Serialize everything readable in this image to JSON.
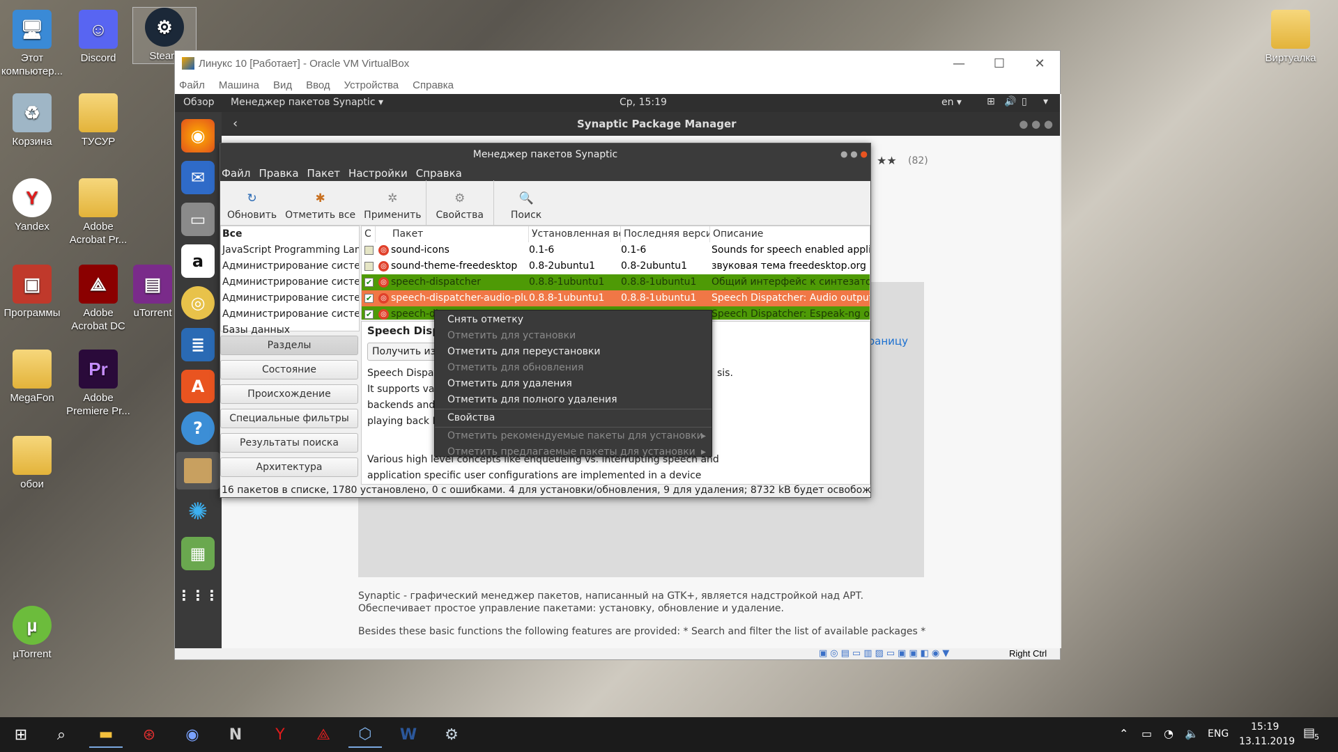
{
  "desktop": {
    "icons": [
      "Этот компьютер...",
      "Discord",
      "Steam",
      "Корзина",
      "ТУСУР",
      "Yandex",
      "Adobe Acrobat Pr...",
      "Программы",
      "Adobe Acrobat DC",
      "uTorrent",
      "MegaFon",
      "Adobe Premiere Pr...",
      "обои",
      "µTorrent",
      "Виртуалка"
    ]
  },
  "vbox": {
    "title": "Линукс 10 [Работает] - Oracle VM VirtualBox",
    "menu": [
      "Файл",
      "Машина",
      "Вид",
      "Ввод",
      "Устройства",
      "Справка"
    ],
    "host_key": "Right Ctrl"
  },
  "gnome": {
    "overview": "Обзор",
    "app_menu": "Менеджер пакетов Synaptic ▾",
    "clock": "Ср, 15:19",
    "lang": "en ▾"
  },
  "software_center": {
    "title": "Synaptic Package Manager",
    "rating_count": "(82)",
    "website_link": "етить домашнюю страницу",
    "desc1": "Synaptic - графический менеджер пакетов, написанный на GTK+, является надстройкой над APT. Обеспечивает простое управление пакетами: установку, обновление и удаление.",
    "desc2": "Besides these basic functions the following features are provided:  * Search and filter the list of available packages  *"
  },
  "synaptic": {
    "title": "Менеджер пакетов Synaptic",
    "menu": [
      "Файл",
      "Правка",
      "Пакет",
      "Настройки",
      "Справка"
    ],
    "toolbar": [
      "Обновить",
      "Отметить все",
      "Применить",
      "Свойства",
      "Поиск"
    ],
    "sections": [
      "Все",
      "JavaScript Programming Lang",
      "Администрирование систем",
      "Администрирование систем",
      "Администрирование систем",
      "Администрирование систем",
      "Базы данных"
    ],
    "filter_buttons": [
      "Разделы",
      "Состояние",
      "Происхождение",
      "Специальные фильтры",
      "Результаты поиска",
      "Архитектура"
    ],
    "columns": [
      "С",
      "Пакет",
      "Установленная ве",
      "Последняя версия",
      "Описание"
    ],
    "rows": [
      {
        "name": "sound-icons",
        "installed": "0.1-6",
        "latest": "0.1-6",
        "desc": "Sounds for speech enabled applic",
        "state": "normal"
      },
      {
        "name": "sound-theme-freedesktop",
        "installed": "0.8-2ubuntu1",
        "latest": "0.8-2ubuntu1",
        "desc": "звуковая тема freedesktop.org",
        "state": "normal"
      },
      {
        "name": "speech-dispatcher",
        "installed": "0.8.8-1ubuntu1",
        "latest": "0.8.8-1ubuntu1",
        "desc": "Общий интерфейс к синтезатор",
        "state": "green"
      },
      {
        "name": "speech-dispatcher-audio-plug",
        "installed": "0.8.8-1ubuntu1",
        "latest": "0.8.8-1ubuntu1",
        "desc": "Speech Dispatcher: Audio output",
        "state": "selected"
      },
      {
        "name": "speech-di",
        "installed": "",
        "latest": "",
        "desc": "Speech Dispatcher: Espeak-ng ou",
        "state": "green"
      }
    ],
    "detail_title": "Speech Disp",
    "get_button": "Получить из",
    "detail_lines": [
      "Speech Dispat",
      "It supports va",
      "backends and",
      "playing back P"
    ],
    "detail_tail": "sis.",
    "detail_bottom1": "Various high level concepts like enqueueing vs. interrupting speech and",
    "detail_bottom2": "application specific user configurations are implemented in a device",
    "status": "16 пакетов в списке, 1780 установлено, 0 с ошибками. 4 для установки/обновления, 9 для удаления; 8732 kB будет освобождено"
  },
  "context_menu": [
    {
      "label": "Снять отметку",
      "enabled": true
    },
    {
      "label": "Отметить для установки",
      "enabled": false
    },
    {
      "label": "Отметить для переустановки",
      "enabled": true
    },
    {
      "label": "Отметить для обновления",
      "enabled": false
    },
    {
      "label": "Отметить для удаления",
      "enabled": true
    },
    {
      "label": "Отметить для полного удаления",
      "enabled": true
    },
    {
      "label": "Свойства",
      "enabled": true
    },
    {
      "label": "Отметить рекомендуемые пакеты для установки",
      "enabled": false
    },
    {
      "label": "Отметить предлагаемые пакеты для установки",
      "enabled": false
    }
  ],
  "taskbar": {
    "lang": "ENG",
    "time": "15:19",
    "date": "13.11.2019",
    "notifications": "5"
  },
  "colors": {
    "green_row": "#4e9a06",
    "selected_row": "#f07746",
    "dark_panel": "#3b3b3b"
  }
}
